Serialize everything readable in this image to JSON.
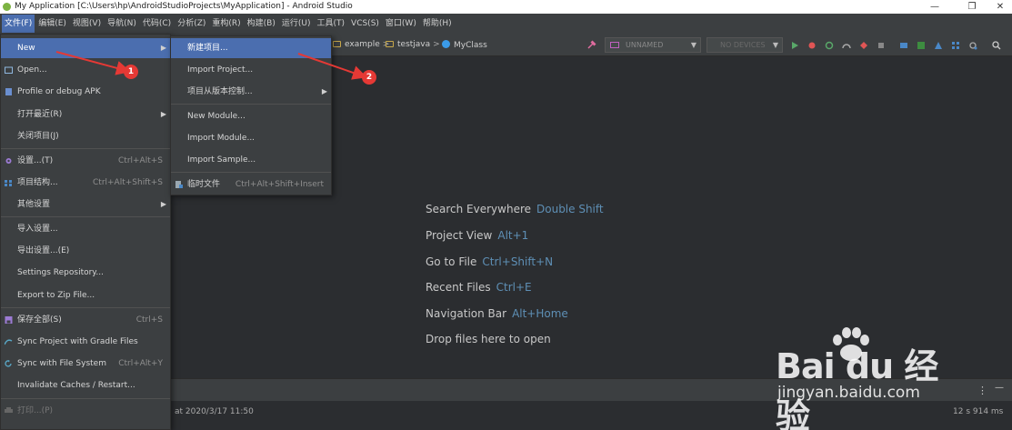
{
  "window": {
    "title": "My Application [C:\\Users\\hp\\AndroidStudioProjects\\MyApplication] - Android Studio",
    "minimize_glyph": "—",
    "restore_glyph": "❐",
    "close_glyph": "✕"
  },
  "menubar": {
    "items": [
      "文件(F)",
      "编辑(E)",
      "视图(V)",
      "导航(N)",
      "代码(C)",
      "分析(Z)",
      "重构(R)",
      "构建(B)",
      "运行(U)",
      "工具(T)",
      "VCS(S)",
      "窗口(W)",
      "帮助(H)"
    ]
  },
  "toolbar": {
    "breadcrumb": [
      "example",
      "testjava",
      "MyClass"
    ],
    "run_config": "UNNAMED",
    "device": "NO DEVICES"
  },
  "file_menu": {
    "items": [
      {
        "label": "New",
        "shortcut": "",
        "submenu": true,
        "icon": ""
      },
      {
        "label": "Open...",
        "shortcut": "",
        "submenu": false,
        "icon": "folder-icon"
      },
      {
        "label": "Profile or debug APK",
        "shortcut": "",
        "submenu": false,
        "icon": "apk-icon"
      },
      {
        "label": "打开最近(R)",
        "shortcut": "",
        "submenu": true,
        "icon": ""
      },
      {
        "label": "关闭项目(J)",
        "shortcut": "",
        "submenu": false,
        "icon": ""
      },
      {
        "label": "设置...(T)",
        "shortcut": "Ctrl+Alt+S",
        "submenu": false,
        "icon": "gear-icon"
      },
      {
        "label": "项目结构...",
        "shortcut": "Ctrl+Alt+Shift+S",
        "submenu": false,
        "icon": "structure-icon"
      },
      {
        "label": "其他设置",
        "shortcut": "",
        "submenu": true,
        "icon": ""
      },
      {
        "label": "导入设置...",
        "shortcut": "",
        "submenu": false,
        "icon": ""
      },
      {
        "label": "导出设置...(E)",
        "shortcut": "",
        "submenu": false,
        "icon": ""
      },
      {
        "label": "Settings Repository...",
        "shortcut": "",
        "submenu": false,
        "icon": ""
      },
      {
        "label": "Export to Zip File...",
        "shortcut": "",
        "submenu": false,
        "icon": ""
      },
      {
        "label": "保存全部(S)",
        "shortcut": "Ctrl+S",
        "submenu": false,
        "icon": "save-icon"
      },
      {
        "label": "Sync Project with Gradle Files",
        "shortcut": "",
        "submenu": false,
        "icon": "gradle-sync-icon"
      },
      {
        "label": "Sync with File System",
        "shortcut": "Ctrl+Alt+Y",
        "submenu": false,
        "icon": "refresh-icon"
      },
      {
        "label": "Invalidate Caches / Restart...",
        "shortcut": "",
        "submenu": false,
        "icon": ""
      },
      {
        "label": "打印...(P)",
        "shortcut": "",
        "submenu": false,
        "icon": "print-icon"
      }
    ]
  },
  "new_submenu": {
    "items": [
      {
        "label": "新建项目...",
        "shortcut": "",
        "submenu": false
      },
      {
        "label": "Import Project...",
        "shortcut": "",
        "submenu": false
      },
      {
        "label": "项目从版本控制...",
        "shortcut": "",
        "submenu": true
      },
      {
        "label": "New Module...",
        "shortcut": "",
        "submenu": false
      },
      {
        "label": "Import Module...",
        "shortcut": "",
        "submenu": false
      },
      {
        "label": "Import Sample...",
        "shortcut": "",
        "submenu": false
      },
      {
        "label": "临时文件",
        "shortcut": "Ctrl+Alt+Shift+Insert",
        "submenu": false
      }
    ]
  },
  "welcome_hints": [
    {
      "label": "Search Everywhere",
      "key": "Double Shift"
    },
    {
      "label": "Project View",
      "key": "Alt+1"
    },
    {
      "label": "Go to File",
      "key": "Ctrl+Shift+N"
    },
    {
      "label": "Recent Files",
      "key": "Ctrl+E"
    },
    {
      "label": "Navigation Bar",
      "key": "Alt+Home"
    },
    {
      "label": "Drop files here to open",
      "key": ""
    }
  ],
  "status": {
    "timestamp": "at 2020/3/17 11:50",
    "duration": "12 s 914 ms",
    "overflow_glyph": "⋮",
    "minimize_glyph": "—"
  },
  "annotations": {
    "badge1": "1",
    "badge2": "2",
    "color": "#e53935"
  },
  "watermark": {
    "brand": "Bai du 经验",
    "url": "jingyan.baidu.com"
  },
  "colors": {
    "highlight": "#4b6eaf",
    "menu_bg": "#3c3f41",
    "editor_bg": "#2b2d30",
    "shortcut_key": "#5e8fb5"
  }
}
